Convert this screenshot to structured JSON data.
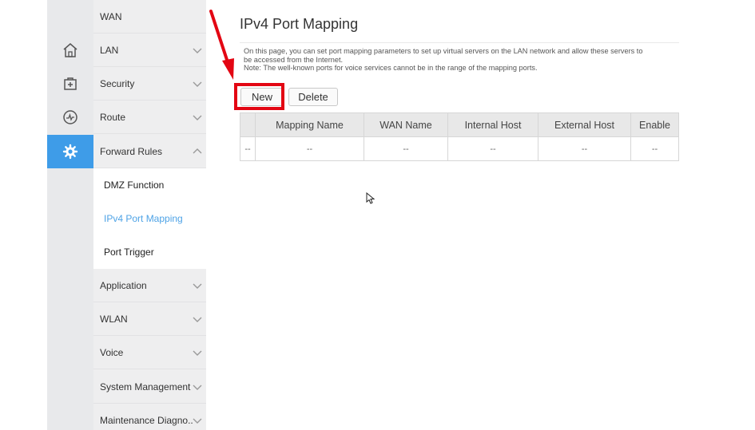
{
  "icon_rail": {
    "items": [
      {
        "name": "home-icon"
      },
      {
        "name": "plus-box-icon"
      },
      {
        "name": "gauge-icon"
      },
      {
        "name": "gear-icon",
        "active": true
      }
    ]
  },
  "sidebar": {
    "items": [
      {
        "label": "WAN",
        "chevron": "none"
      },
      {
        "label": "LAN",
        "chevron": "down"
      },
      {
        "label": "Security",
        "chevron": "down"
      },
      {
        "label": "Route",
        "chevron": "down"
      },
      {
        "label": "Forward Rules",
        "chevron": "up"
      }
    ],
    "sub_items": [
      {
        "label": "DMZ Function"
      },
      {
        "label": "IPv4 Port Mapping",
        "active": true
      },
      {
        "label": "Port Trigger"
      }
    ],
    "items_after": [
      {
        "label": "Application",
        "chevron": "down"
      },
      {
        "label": "WLAN",
        "chevron": "down"
      },
      {
        "label": "Voice",
        "chevron": "down"
      },
      {
        "label": "System Management",
        "chevron": "down"
      },
      {
        "label": "Maintenance Diagno..",
        "chevron": "down"
      }
    ]
  },
  "main": {
    "title": "IPv4 Port Mapping",
    "description_line1": "On this page, you can set port mapping parameters to set up virtual servers on the LAN network and allow these servers to",
    "description_line2": "be accessed from the Internet.",
    "description_line3": "Note: The well-known ports for voice services cannot be in the range of the mapping ports.",
    "buttons": {
      "new_label": "New",
      "delete_label": "Delete"
    },
    "table": {
      "headers": [
        "",
        "Mapping Name",
        "WAN Name",
        "Internal Host",
        "External Host",
        "Enable"
      ],
      "rows": [
        [
          "--",
          "--",
          "--",
          "--",
          "--",
          "--"
        ]
      ]
    }
  },
  "colors": {
    "accent": "#3e9ce8",
    "active_text": "#4ea3e6",
    "annotation": "#e30613"
  }
}
